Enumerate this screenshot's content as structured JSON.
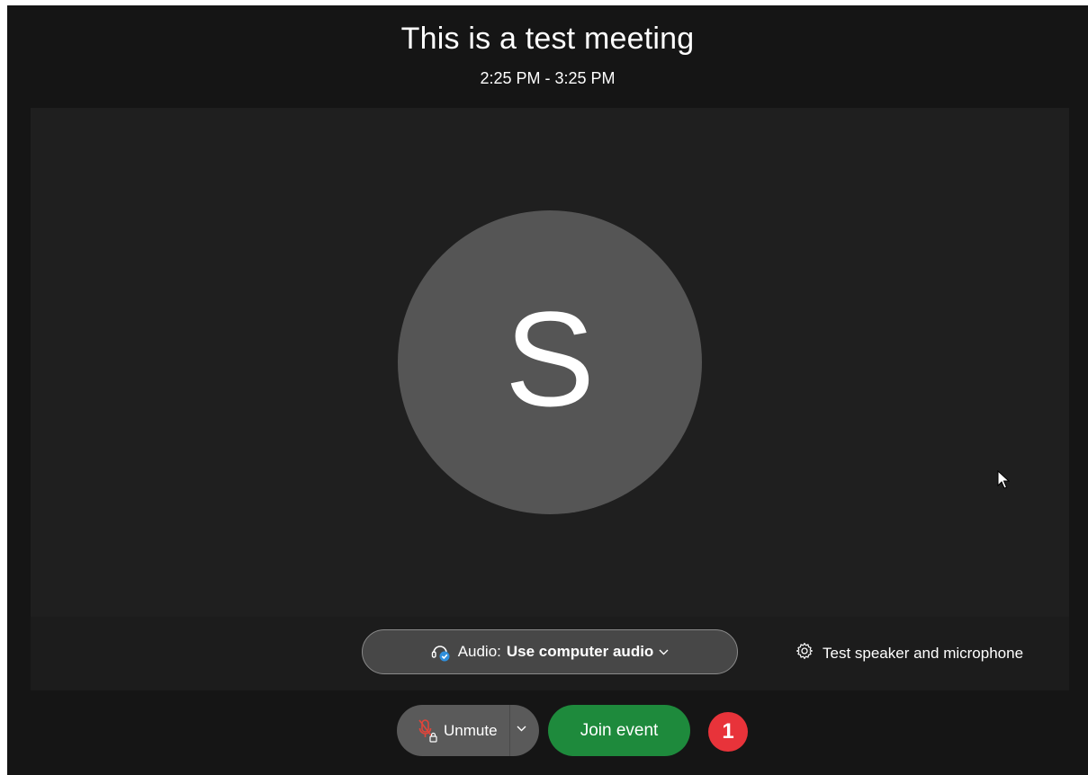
{
  "meeting": {
    "title": "This is a test meeting",
    "time_range": "2:25 PM - 3:25 PM"
  },
  "avatar": {
    "initial": "S",
    "color": "#555555"
  },
  "audio": {
    "prefix": "Audio:",
    "selection": "Use computer audio",
    "icon": "headset-connected-icon"
  },
  "test_audio": {
    "label": "Test speaker and microphone",
    "icon": "gear-icon"
  },
  "controls": {
    "unmute_label": "Unmute",
    "unmute_icon": "muted-mic-locked-icon",
    "join_label": "Join event",
    "join_color": "#1e8a3c"
  },
  "annotation": {
    "badge_number": "1",
    "badge_color": "#e8333a"
  }
}
